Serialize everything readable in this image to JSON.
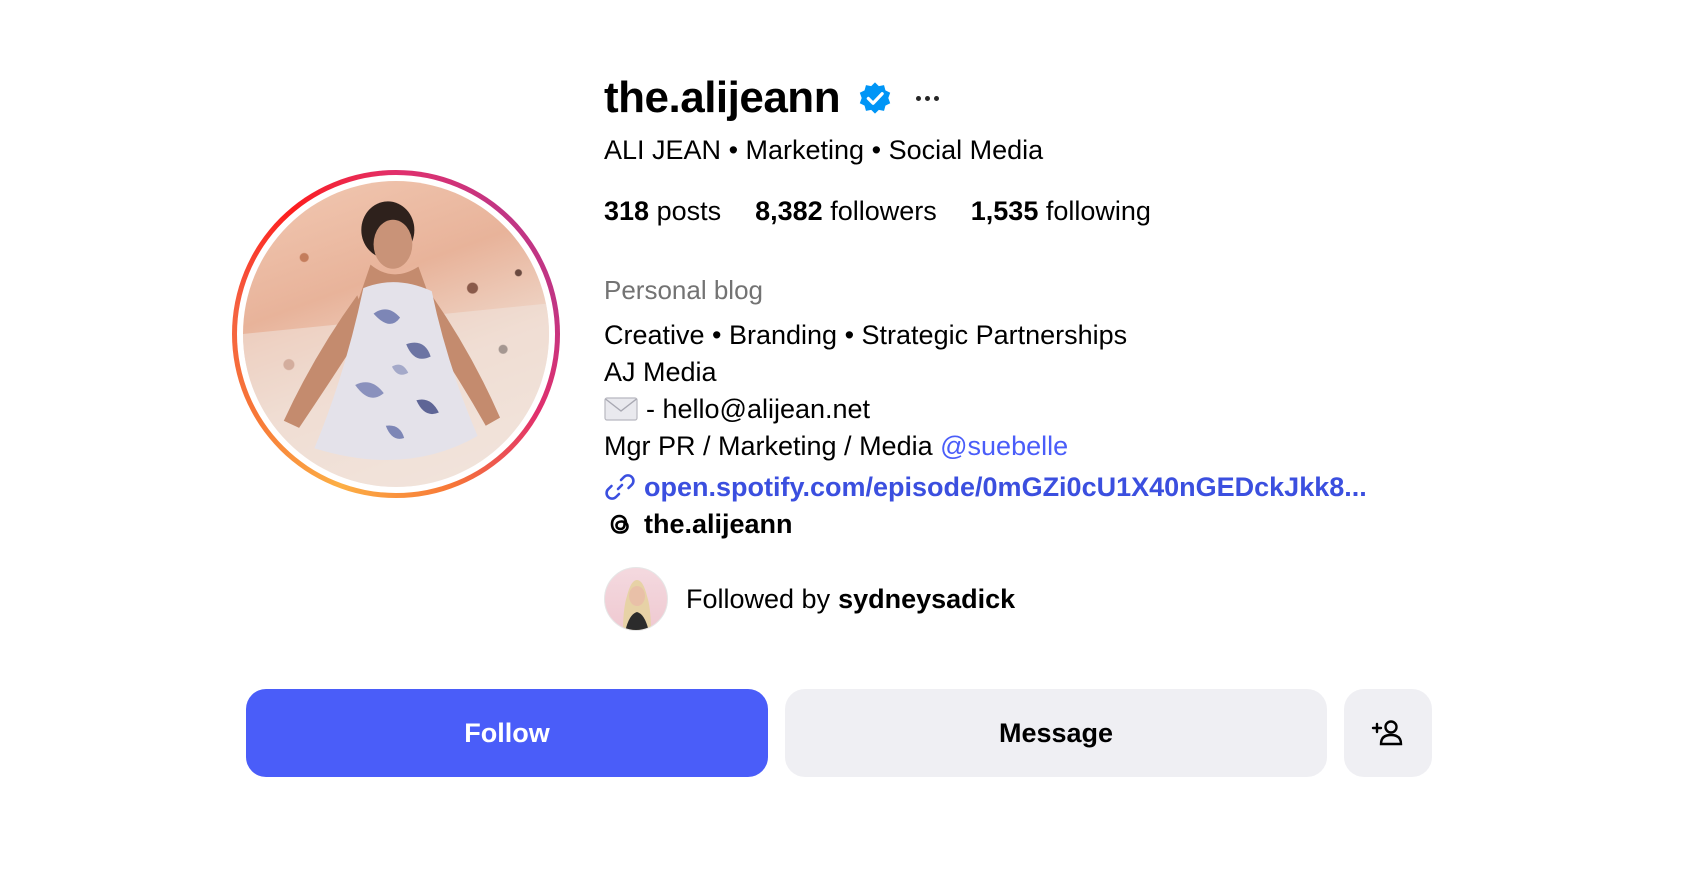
{
  "profile": {
    "username": "the.alijeann",
    "full_name": "ALI JEAN",
    "headline_parts": [
      "Marketing",
      "Social Media"
    ],
    "category": "Personal blog"
  },
  "stats": {
    "posts_count": "318",
    "posts_label": "posts",
    "followers_count": "8,382",
    "followers_label": "followers",
    "following_count": "1,535",
    "following_label": "following"
  },
  "bio": {
    "line1": "Creative • Branding • Strategic Partnerships",
    "line2": "AJ Media",
    "line3": "- hello@alijean.net",
    "line4_prefix": "Mgr PR / Marketing / Media",
    "line4_mention": "@suebelle"
  },
  "link": {
    "text": "open.spotify.com/episode/0mGZi0cU1X40nGEDckJkk8..."
  },
  "threads": {
    "handle": "the.alijeann"
  },
  "followed_by": {
    "prefix": "Followed by",
    "user": "sydneysadick"
  },
  "actions": {
    "follow_label": "Follow",
    "message_label": "Message"
  },
  "icons": {
    "verified": "verified-badge-icon",
    "more": "more-options-icon",
    "envelope": "envelope-icon",
    "link": "link-icon",
    "threads": "threads-icon",
    "suggest": "add-person-icon"
  },
  "colors": {
    "primary_button": "#4a5df9",
    "secondary_button": "#efeff3",
    "link": "#3b4fdf",
    "verified": "#0095f6",
    "muted_text": "#737373"
  }
}
